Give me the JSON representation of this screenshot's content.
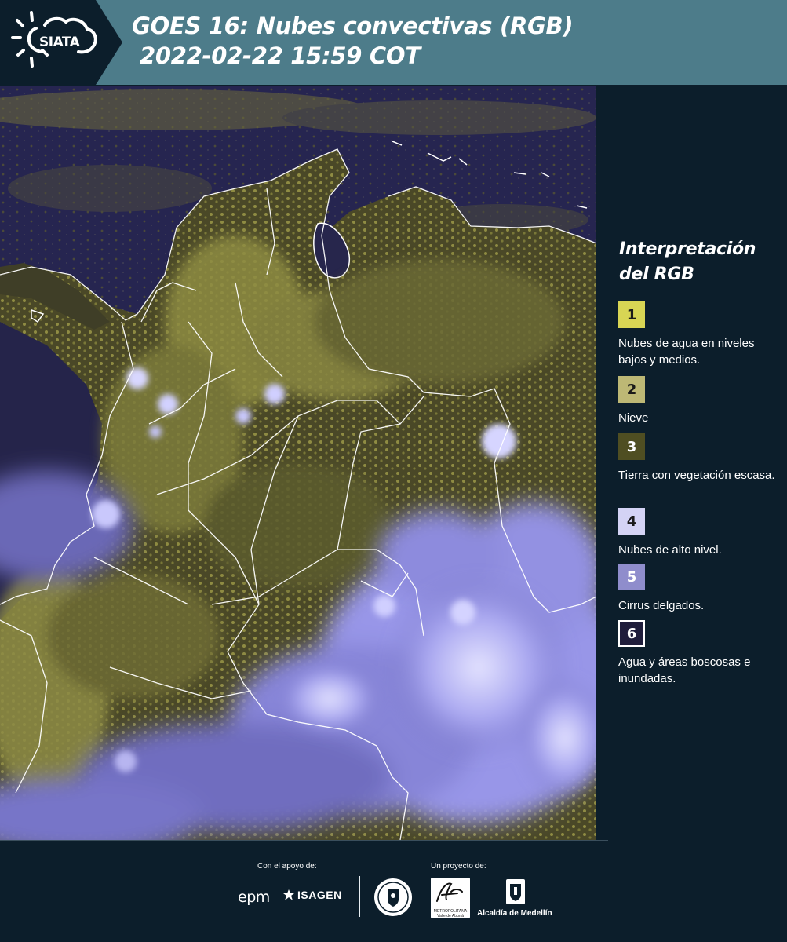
{
  "header": {
    "logo_text": "SIATA",
    "title_line1": "GOES 16: Nubes convectivas (RGB)",
    "title_line2": "2022-02-22 15:59 COT"
  },
  "legend": {
    "title_line1": "Interpretación",
    "title_line2": "del RGB",
    "items": [
      {
        "number": "1",
        "color": "#d8d554",
        "label": "Nubes de agua en niveles bajos y medios."
      },
      {
        "number": "2",
        "color": "#bdb875",
        "label": "Nieve"
      },
      {
        "number": "3",
        "color": "#4f4e22",
        "label": "Tierra con vegetación escasa."
      },
      {
        "number": "4",
        "color": "#d4d3f5",
        "label": "Nubes de alto nivel."
      },
      {
        "number": "5",
        "color": "#8f8dcc",
        "label": "Cirrus delgados."
      },
      {
        "number": "6",
        "color": "#1f1d3b",
        "label": "Agua y áreas boscosas e inundadas."
      }
    ]
  },
  "footer": {
    "support_label": "Con el apoyo de:",
    "project_label": "Un proyecto de:",
    "sponsor1": "epm",
    "sponsor2": "ISAGEN",
    "area_logo_text": "METROPOLITANA Valle de Aburrá",
    "alcaldia_label": "Alcaldía de Medellín"
  },
  "map": {
    "ocean_color": "#24234a",
    "land_color": "#3b3a25",
    "low_cloud_color": "#a8a64a",
    "high_cloud_color": "#b5b3f4",
    "border_color": "#ffffff"
  }
}
